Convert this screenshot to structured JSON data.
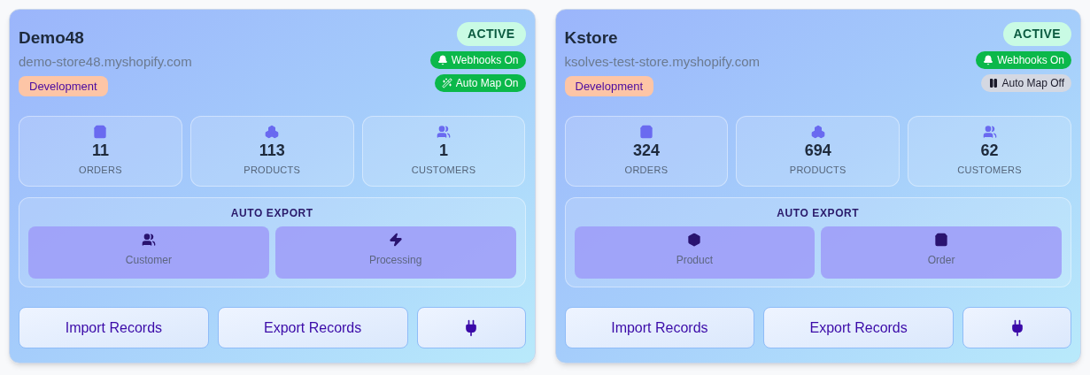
{
  "stores": [
    {
      "name": "Demo48",
      "domain": "demo-store48.myshopify.com",
      "status": "ACTIVE",
      "environment": "Development",
      "badges": [
        {
          "kind": "webhooks",
          "label": "Webhooks On",
          "on": true
        },
        {
          "kind": "automap",
          "label": "Auto Map On",
          "on": true
        }
      ],
      "stats": [
        {
          "kind": "orders",
          "value": "11",
          "label": "ORDERS"
        },
        {
          "kind": "products",
          "value": "113",
          "label": "PRODUCTS"
        },
        {
          "kind": "customers",
          "value": "1",
          "label": "CUSTOMERS"
        }
      ],
      "auto_export": {
        "title": "AUTO EXPORT",
        "items": [
          {
            "kind": "customer",
            "label": "Customer"
          },
          {
            "kind": "processing",
            "label": "Processing"
          }
        ]
      },
      "buttons": [
        {
          "kind": "text",
          "label": "Import Records"
        },
        {
          "kind": "text",
          "label": "Export Records"
        },
        {
          "kind": "plug"
        }
      ]
    },
    {
      "name": "Kstore",
      "domain": "ksolves-test-store.myshopify.com",
      "status": "ACTIVE",
      "environment": "Development",
      "badges": [
        {
          "kind": "webhooks",
          "label": "Webhooks On",
          "on": true
        },
        {
          "kind": "automap",
          "label": "Auto Map Off",
          "on": false
        }
      ],
      "stats": [
        {
          "kind": "orders",
          "value": "324",
          "label": "ORDERS"
        },
        {
          "kind": "products",
          "value": "694",
          "label": "PRODUCTS"
        },
        {
          "kind": "customers",
          "value": "62",
          "label": "CUSTOMERS"
        }
      ],
      "auto_export": {
        "title": "AUTO EXPORT",
        "items": [
          {
            "kind": "product",
            "label": "Product"
          },
          {
            "kind": "order",
            "label": "Order"
          }
        ]
      },
      "buttons": [
        {
          "kind": "text",
          "label": "Import Records"
        },
        {
          "kind": "text",
          "label": "Export Records"
        },
        {
          "kind": "plug"
        }
      ]
    }
  ]
}
